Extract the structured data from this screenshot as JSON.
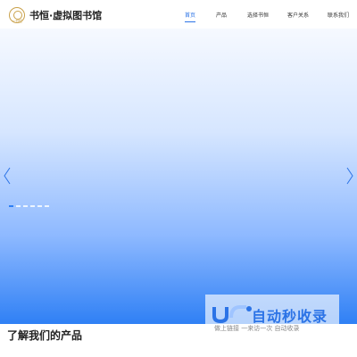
{
  "header": {
    "logo_text": "一书恒",
    "site_title": "书恒·虚拟图书馆",
    "nav": [
      {
        "label": "首页",
        "active": true
      },
      {
        "label": "产品",
        "active": false
      },
      {
        "label": "选择书恒",
        "active": false
      },
      {
        "label": "客户关系",
        "active": false
      },
      {
        "label": "联系我们",
        "active": false
      }
    ]
  },
  "hero": {
    "prev_icon": "chevron-left-icon",
    "next_icon": "chevron-right-icon",
    "slide_count": 6,
    "active_slide": 1
  },
  "watermark": {
    "brand": "自动秒收录",
    "slogan": "做上链接 一来访一次 自动收录"
  },
  "section": {
    "title": "了解我们的产品"
  },
  "colors": {
    "accent": "#2b73e6",
    "logo_gold": "#c9a14a",
    "hero_bottom": "#2f80f5"
  }
}
